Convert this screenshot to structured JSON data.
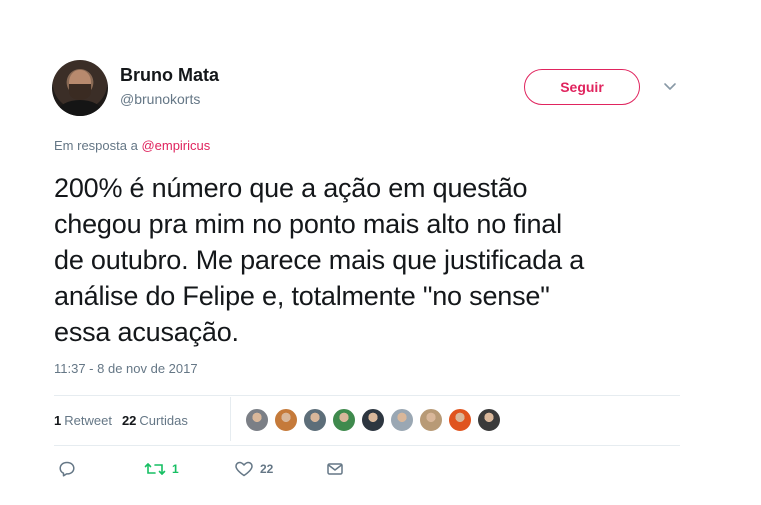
{
  "user": {
    "display_name": "Bruno Mata",
    "handle": "@brunokorts",
    "avatar_icon": "user-avatar"
  },
  "header": {
    "follow_label": "Seguir",
    "more_icon": "chevron-down-icon"
  },
  "reply": {
    "prefix": "Em resposta a ",
    "mention": "@empiricus"
  },
  "tweet": {
    "text": "200% é número que a ação em questão\nchegou pra mim no ponto mais alto no final\nde outubro. Me parece mais que justificada a\nanálise do Felipe e, totalmente \"no sense\"\nessa acusação.",
    "timestamp": "11:37 - 8 de nov de 2017"
  },
  "stats": {
    "retweets_count": "1",
    "retweets_label": "Retweet",
    "likes_count": "22",
    "likes_label": "Curtidas"
  },
  "likers": [
    {
      "name": "liker-1",
      "color": "#7b7f86"
    },
    {
      "name": "liker-2",
      "color": "#c57a3a"
    },
    {
      "name": "liker-3",
      "color": "#5d6e79"
    },
    {
      "name": "liker-4",
      "color": "#3f8a4d"
    },
    {
      "name": "liker-5",
      "color": "#2d3640"
    },
    {
      "name": "liker-6",
      "color": "#9aa7b3"
    },
    {
      "name": "liker-7",
      "color": "#b89a76"
    },
    {
      "name": "liker-8",
      "color": "#e0541e"
    },
    {
      "name": "liker-9",
      "color": "#3a3a3a"
    }
  ],
  "actions": {
    "reply_icon": "reply-icon",
    "retweet_icon": "retweet-icon",
    "retweet_count": "1",
    "like_icon": "heart-icon",
    "like_count": "22",
    "dm_icon": "envelope-icon"
  },
  "colors": {
    "accent": "#e0245e",
    "retweet": "#17bf63",
    "muted": "#657786",
    "text": "#14171a"
  }
}
